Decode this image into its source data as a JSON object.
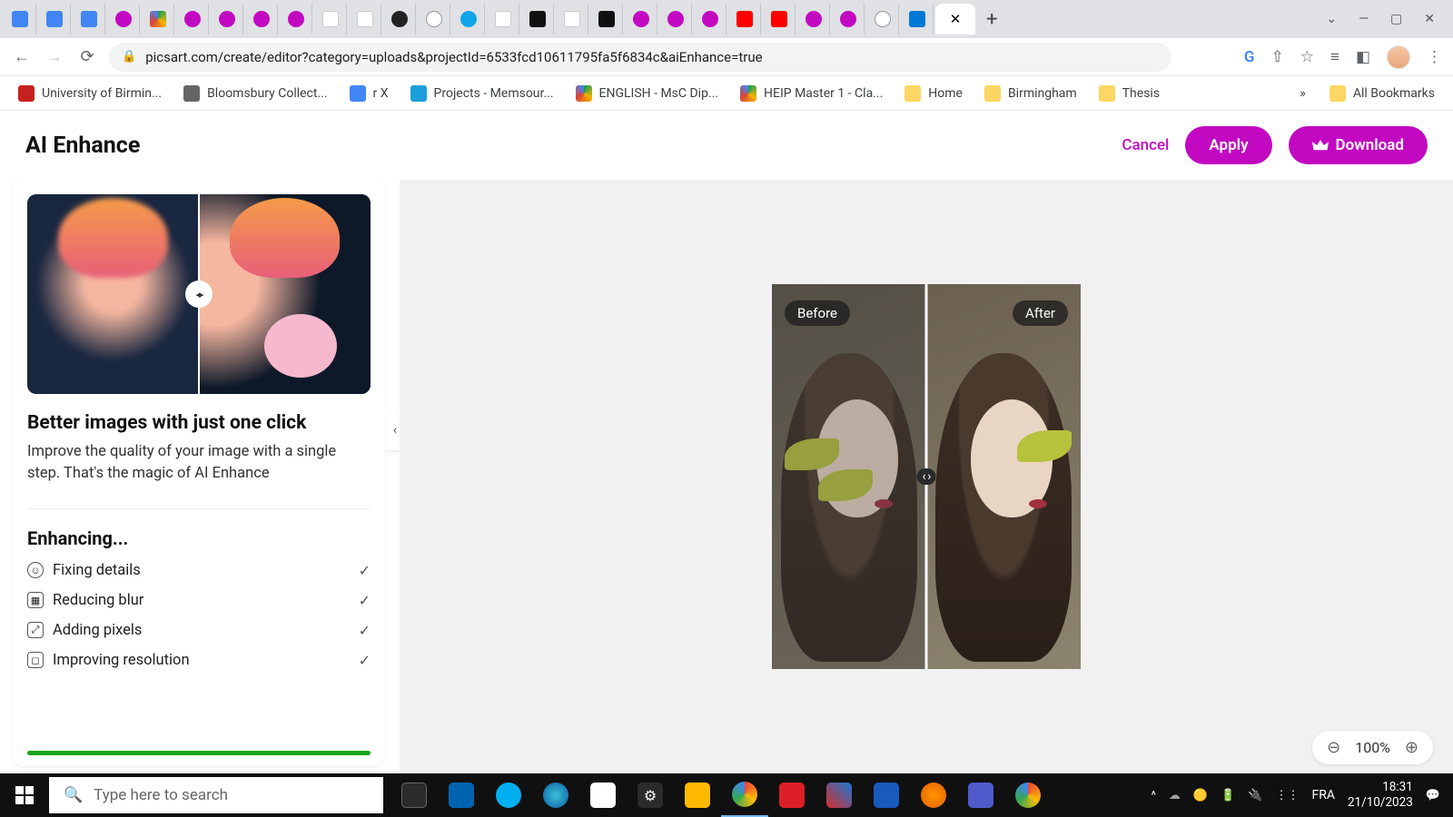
{
  "browser": {
    "url": "picsart.com/create/editor?category=uploads&projectId=6533fcd10611795fa5f6834c&aiEnhance=true",
    "tabs": [
      "docs",
      "docs",
      "docs",
      "picsart",
      "drive",
      "picsart",
      "picsart",
      "picsart",
      "picsart",
      "google",
      "wikipedia",
      "misc",
      "chrome",
      "misc",
      "google",
      "misc",
      "google",
      "misc",
      "picsart",
      "picsart",
      "picsart",
      "youtube",
      "youtube",
      "picsart",
      "picsart",
      "chrome",
      "outlook"
    ],
    "window_controls": {
      "min": "—",
      "max": "▢",
      "close": "✕",
      "dropdown": "⌄"
    },
    "addr_icons": {
      "google": "G",
      "share": "⇪",
      "star": "☆",
      "list": "≡",
      "panel": "▣",
      "menu": "⋮"
    },
    "bookmarks": [
      {
        "label": "University of Birmin...",
        "color": "#c5221f"
      },
      {
        "label": "Bloomsbury Collect...",
        "color": "#555"
      },
      {
        "label": "r X",
        "color": "#4285f4"
      },
      {
        "label": "Projects - Memsour...",
        "color": "#1a9edb"
      },
      {
        "label": "ENGLISH - MsC Dip...",
        "color": "drive"
      },
      {
        "label": "HEIP Master 1 - Cla...",
        "color": "drive"
      },
      {
        "label": "Home",
        "color": "fold"
      },
      {
        "label": "Birmingham",
        "color": "fold"
      },
      {
        "label": "Thesis",
        "color": "fold"
      }
    ],
    "bm_overflow": "»",
    "all_bookmarks": "All Bookmarks"
  },
  "app": {
    "title": "AI Enhance",
    "cancel": "Cancel",
    "apply": "Apply",
    "download": "Download",
    "panel": {
      "heading": "Better images with just one click",
      "desc": "Improve the quality of your image with a single step. That's the magic of AI Enhance",
      "steps_title": "Enhancing...",
      "steps": [
        {
          "label": "Fixing details"
        },
        {
          "label": "Reducing blur"
        },
        {
          "label": "Adding pixels"
        },
        {
          "label": "Improving resolution"
        }
      ],
      "check": "✓"
    },
    "compare": {
      "before": "Before",
      "after": "After"
    },
    "zoom": {
      "value": "100%"
    }
  },
  "taskbar": {
    "search_placeholder": "Type here to search",
    "lang": "FRA",
    "time": "18:31",
    "date": "21/10/2023"
  }
}
